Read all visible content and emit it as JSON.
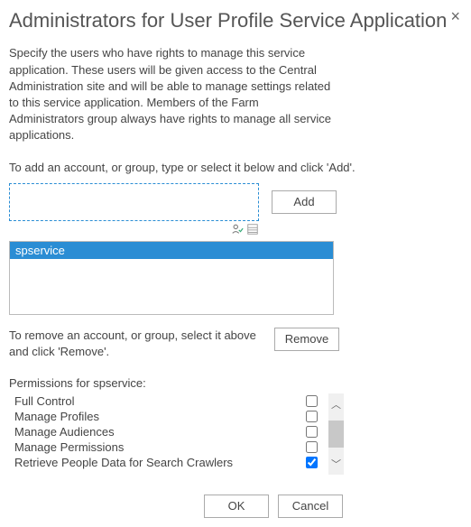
{
  "dialog": {
    "title": "Administrators for User Profile Service Application",
    "close": "×",
    "description": "Specify the users who have rights to manage this service application. These users will be given access to the Central Administration site and will be able to manage settings related to this service application. Members of the Farm Administrators group always have rights to manage all service applications.",
    "add_instruction": "To add an account, or group, type or select it below and click 'Add'.",
    "remove_instruction": "To remove an account, or group, select it above and click 'Remove'.",
    "input_value": ""
  },
  "buttons": {
    "add": "Add",
    "remove": "Remove",
    "ok": "OK",
    "cancel": "Cancel"
  },
  "list": {
    "items": [
      {
        "label": "spservice",
        "selected": true
      }
    ]
  },
  "permissions": {
    "title": "Permissions for spservice:",
    "rows": [
      {
        "label": "Full Control",
        "checked": false
      },
      {
        "label": "Manage Profiles",
        "checked": false
      },
      {
        "label": "Manage Audiences",
        "checked": false
      },
      {
        "label": "Manage Permissions",
        "checked": false
      },
      {
        "label": "Retrieve People Data for Search Crawlers",
        "checked": true
      }
    ]
  }
}
